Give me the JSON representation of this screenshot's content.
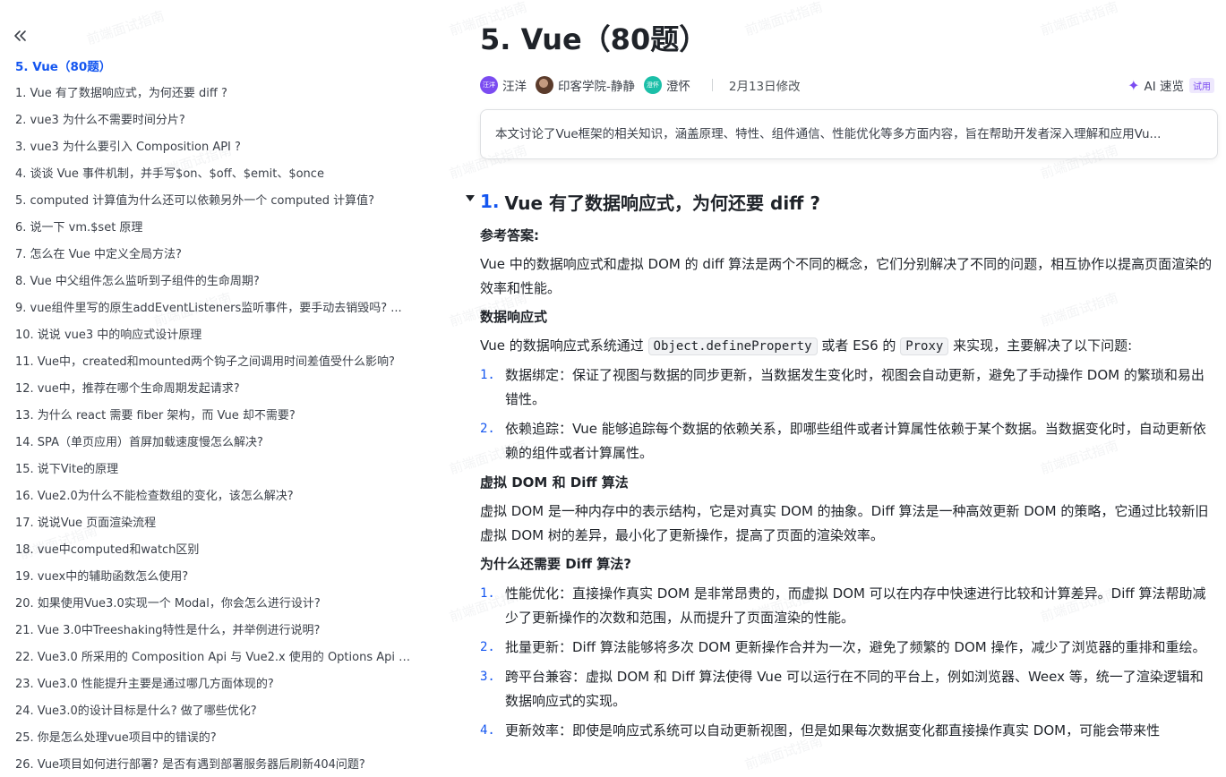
{
  "sidebar": {
    "items": [
      "5. Vue（80题）",
      "1. Vue 有了数据响应式，为何还要 diff ?",
      "2. vue3 为什么不需要时间分片?",
      "3. vue3 为什么要引入 Composition API ?",
      "4. 谈谈 Vue 事件机制，并手写$on、$off、$emit、$once",
      "5. computed 计算值为什么还可以依赖另外一个 computed 计算值?",
      "6. 说一下 vm.$set 原理",
      "7. 怎么在 Vue 中定义全局方法?",
      "8. Vue 中父组件怎么监听到子组件的生命周期?",
      "9. vue组件里写的原生addEventListeners监听事件，要手动去销毁吗? ...",
      "10. 说说 vue3 中的响应式设计原理",
      "11. Vue中，created和mounted两个钩子之间调用时间差值受什么影响?",
      "12. vue中，推荐在哪个生命周期发起请求?",
      "13. 为什么 react 需要 fiber 架构，而 Vue 却不需要?",
      "14. SPA（单页应用）首屏加载速度慢怎么解决?",
      "15. 说下Vite的原理",
      "16. Vue2.0为什么不能检查数组的变化，该怎么解决?",
      "17. 说说Vue 页面渲染流程",
      "18. vue中computed和watch区别",
      "19. vuex中的辅助函数怎么使用?",
      "20. 如果使用Vue3.0实现一个 Modal，你会怎么进行设计?",
      "21. Vue 3.0中Treeshaking特性是什么，并举例进行说明?",
      "22. Vue3.0 所采用的 Composition Api 与 Vue2.x 使用的 Options Api 有...",
      "23. Vue3.0 性能提升主要是通过哪几方面体现的?",
      "24. Vue3.0的设计目标是什么? 做了哪些优化?",
      "25. 你是怎么处理vue项目中的错误的?",
      "26. Vue项目如何进行部署? 是否有遇到部署服务器后刷新404问题?"
    ]
  },
  "doc": {
    "title": "5. Vue（80题）",
    "authors": [
      {
        "name": "汪洋",
        "avatar_text": "汪洋",
        "color": "#7b4cf1"
      },
      {
        "name": "印客学院-静静",
        "avatar_text": "",
        "color": "#5b3b2b"
      },
      {
        "name": "澄怀",
        "avatar_text": "澄怀",
        "color": "#1bbfa8"
      }
    ],
    "modified": "2月13日修改",
    "ai_label": "AI 速览",
    "ai_badge": "试用",
    "summary": "本文讨论了Vue框架的相关知识，涵盖原理、特性、组件通信、性能优化等多方面内容，旨在帮助开发者深入理解和应用Vu..."
  },
  "section": {
    "num": "1.",
    "title": "Vue 有了数据响应式，为何还要 diff ?",
    "ref_label": "参考答案:",
    "intro": "Vue 中的数据响应式和虚拟 DOM 的 diff 算法是两个不同的概念，它们分别解决了不同的问题，相互协作以提高页面渲染的效率和性能。",
    "h_reactive": "数据响应式",
    "reactive_p": {
      "pre": "Vue 的数据响应式系统通过",
      "code1": "Object.defineProperty",
      "mid": "或者 ES6 的",
      "code2": "Proxy",
      "post": "来实现，主要解决了以下问题:"
    },
    "reactive_list": [
      {
        "num": "1.",
        "text": "数据绑定：保证了视图与数据的同步更新，当数据发生变化时，视图会自动更新，避免了手动操作 DOM 的繁琐和易出错性。"
      },
      {
        "num": "2.",
        "text": "依赖追踪：Vue 能够追踪每个数据的依赖关系，即哪些组件或者计算属性依赖于某个数据。当数据变化时，自动更新依赖的组件或者计算属性。"
      }
    ],
    "h_vdom": "虚拟 DOM 和 Diff 算法",
    "vdom_p": "虚拟 DOM 是一种内存中的表示结构，它是对真实 DOM 的抽象。Diff 算法是一种高效更新 DOM 的策略，它通过比较新旧虚拟 DOM 树的差异，最小化了更新操作，提高了页面的渲染效率。",
    "h_why": "为什么还需要 Diff 算法?",
    "why_list": [
      {
        "num": "1.",
        "text": "性能优化：直接操作真实 DOM 是非常昂贵的，而虚拟 DOM 可以在内存中快速进行比较和计算差异。Diff 算法帮助减少了更新操作的次数和范围，从而提升了页面渲染的性能。"
      },
      {
        "num": "2.",
        "text": "批量更新：Diff 算法能够将多次 DOM 更新操作合并为一次，避免了频繁的 DOM 操作，减少了浏览器的重排和重绘。"
      },
      {
        "num": "3.",
        "text": "跨平台兼容：虚拟 DOM 和 Diff 算法使得 Vue 可以运行在不同的平台上，例如浏览器、Weex 等，统一了渲染逻辑和数据响应式的实现。"
      },
      {
        "num": "4.",
        "text": "更新效率：即使是响应式系统可以自动更新视图，但是如果每次数据变化都直接操作真实 DOM，可能会带来性"
      }
    ]
  },
  "watermark": "前端面试指南",
  "colors": {
    "accent": "#1456f0",
    "text": "#1f2329",
    "ai": "#7b4cf1"
  }
}
